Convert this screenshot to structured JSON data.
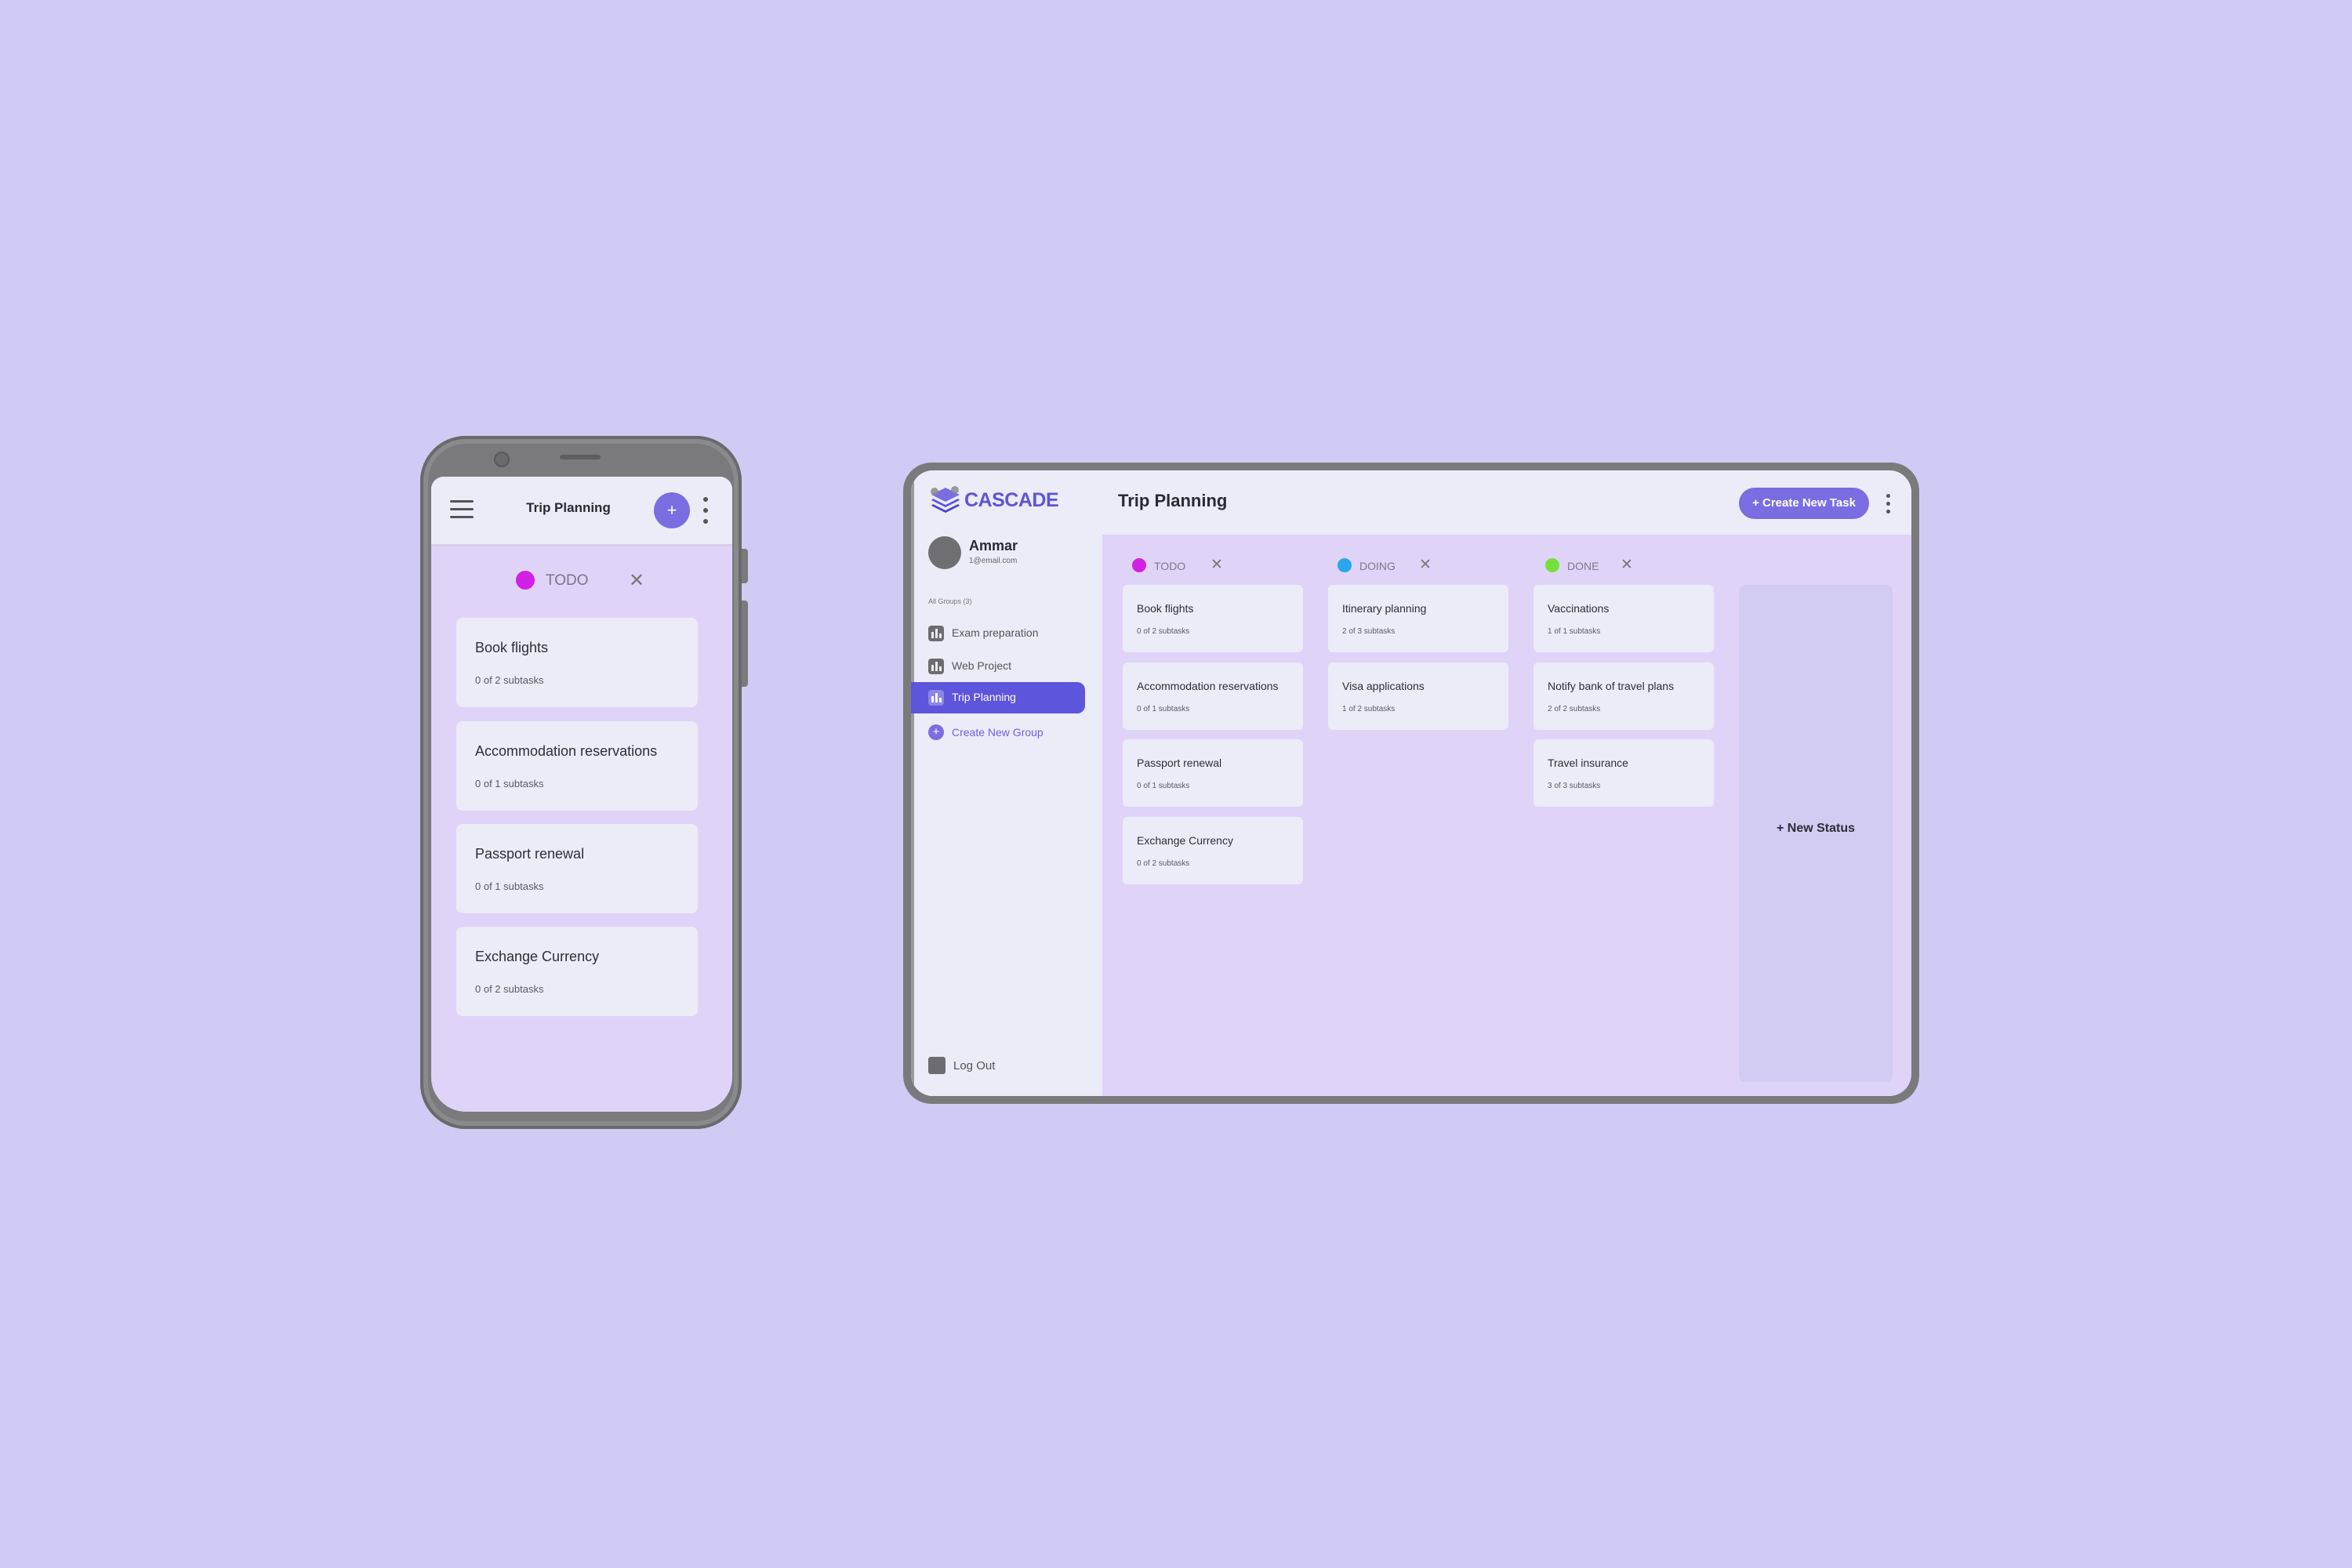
{
  "phone": {
    "title": "Trip Planning",
    "add_label": "+",
    "status": {
      "label": "TODO",
      "color": "#d320e6",
      "close": "✕"
    },
    "cards": [
      {
        "title": "Book flights",
        "subtasks": "0 of 2 subtasks"
      },
      {
        "title": "Accommodation reservations",
        "subtasks": "0 of 1 subtasks"
      },
      {
        "title": "Passport renewal",
        "subtasks": "0 of 1 subtasks"
      },
      {
        "title": "Exchange Currency",
        "subtasks": "0 of 2 subtasks"
      }
    ]
  },
  "tablet": {
    "logo": "CASCADE",
    "user": {
      "name": "Ammar",
      "email": "1@email.com"
    },
    "groups_label": "All Groups (3)",
    "groups": [
      {
        "label": "Exam preparation",
        "active": false
      },
      {
        "label": "Web Project",
        "active": false
      },
      {
        "label": "Trip Planning",
        "active": true
      }
    ],
    "create_group": {
      "icon": "+",
      "label": "Create New Group"
    },
    "logout_label": "Log Out",
    "board_title": "Trip Planning",
    "create_task_label": "+ Create New Task",
    "columns": [
      {
        "label": "TODO",
        "color": "#d320e6",
        "close": "✕",
        "cards": [
          {
            "title": "Book flights",
            "subtasks": "0 of 2 subtasks"
          },
          {
            "title": "Accommodation reservations",
            "subtasks": "0 of 1 subtasks"
          },
          {
            "title": "Passport renewal",
            "subtasks": "0 of 1 subtasks"
          },
          {
            "title": "Exchange Currency",
            "subtasks": "0 of 2 subtasks"
          }
        ]
      },
      {
        "label": "DOING",
        "color": "#2aa6ee",
        "close": "✕",
        "cards": [
          {
            "title": "Itinerary planning",
            "subtasks": "2 of 3 subtasks"
          },
          {
            "title": "Visa applications",
            "subtasks": "1 of 2 subtasks"
          }
        ]
      },
      {
        "label": "DONE",
        "color": "#74e03c",
        "close": "✕",
        "cards": [
          {
            "title": "Vaccinations",
            "subtasks": "1 of 1 subtasks"
          },
          {
            "title": "Notify bank of travel plans",
            "subtasks": "2 of 2 subtasks"
          },
          {
            "title": "Travel insurance",
            "subtasks": "3 of 3 subtasks"
          }
        ]
      }
    ],
    "new_status_label": "+ New Status"
  },
  "icons": {
    "menu": "hamburger-menu-icon",
    "more": "vertical-dots-icon",
    "close": "close-icon",
    "group": "bar-chart-icon",
    "logout": "logout-icon",
    "logo": "stacked-layers-icon"
  },
  "colors": {
    "background": "#d0cbf4",
    "accent": "#7a6de2",
    "active_nav": "#5d55dc"
  }
}
